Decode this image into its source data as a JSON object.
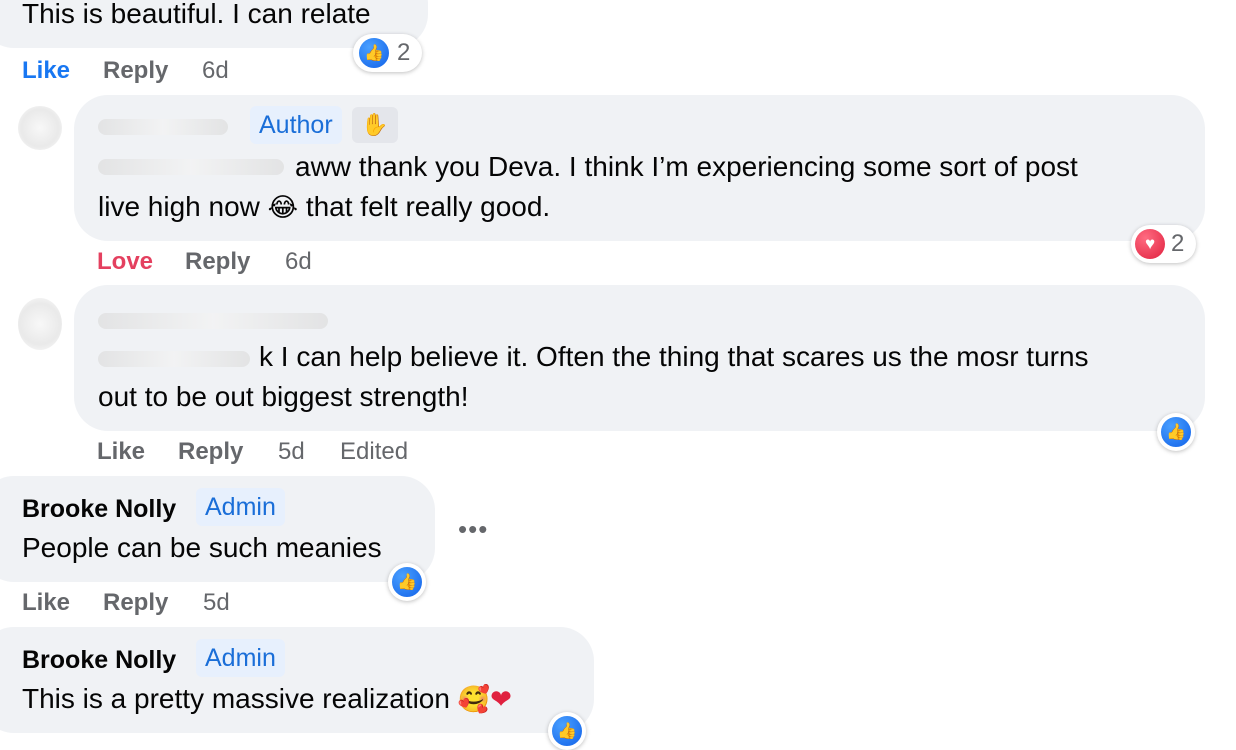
{
  "comments": [
    {
      "text": "This is beautiful. I can relate",
      "actions": {
        "like": "Like",
        "reply": "Reply",
        "time": "6d"
      },
      "reaction": {
        "icon": "like-icon",
        "count": "2"
      }
    },
    {
      "author_badge": "Author",
      "text_line1": "aww thank you Deva. I think I’m experiencing some sort of post",
      "text_line2a": "live high now",
      "text_line2b": "that felt really good.",
      "emoji": "😂",
      "actions": {
        "like": "Love",
        "reply": "Reply",
        "time": "6d"
      },
      "reaction": {
        "icon": "heart-icon",
        "count": "2"
      }
    },
    {
      "text_line1": "k I can help believe it. Often the thing that scares us the mosr turns",
      "text_line2": "out to be out biggest strength!",
      "actions": {
        "like": "Like",
        "reply": "Reply",
        "time": "5d",
        "edited": "Edited"
      },
      "reaction": {
        "icon": "like-icon"
      }
    },
    {
      "name": "Brooke Nolly",
      "badge": "Admin",
      "text": "People can be such meanies",
      "more": "•••",
      "actions": {
        "like": "Like",
        "reply": "Reply",
        "time": "5d"
      },
      "reaction": {
        "icon": "like-icon"
      }
    },
    {
      "name": "Brooke Nolly",
      "badge": "Admin",
      "text": "This is a pretty massive realization",
      "emoji": "🥰❤",
      "reaction": {
        "icon": "like-icon"
      }
    }
  ],
  "colors": {
    "bubble": "#f0f2f5",
    "like": "#1877f2",
    "love": "#e4405f",
    "badge_bg": "#e7f0fd",
    "badge_text": "#1a6ed8"
  }
}
